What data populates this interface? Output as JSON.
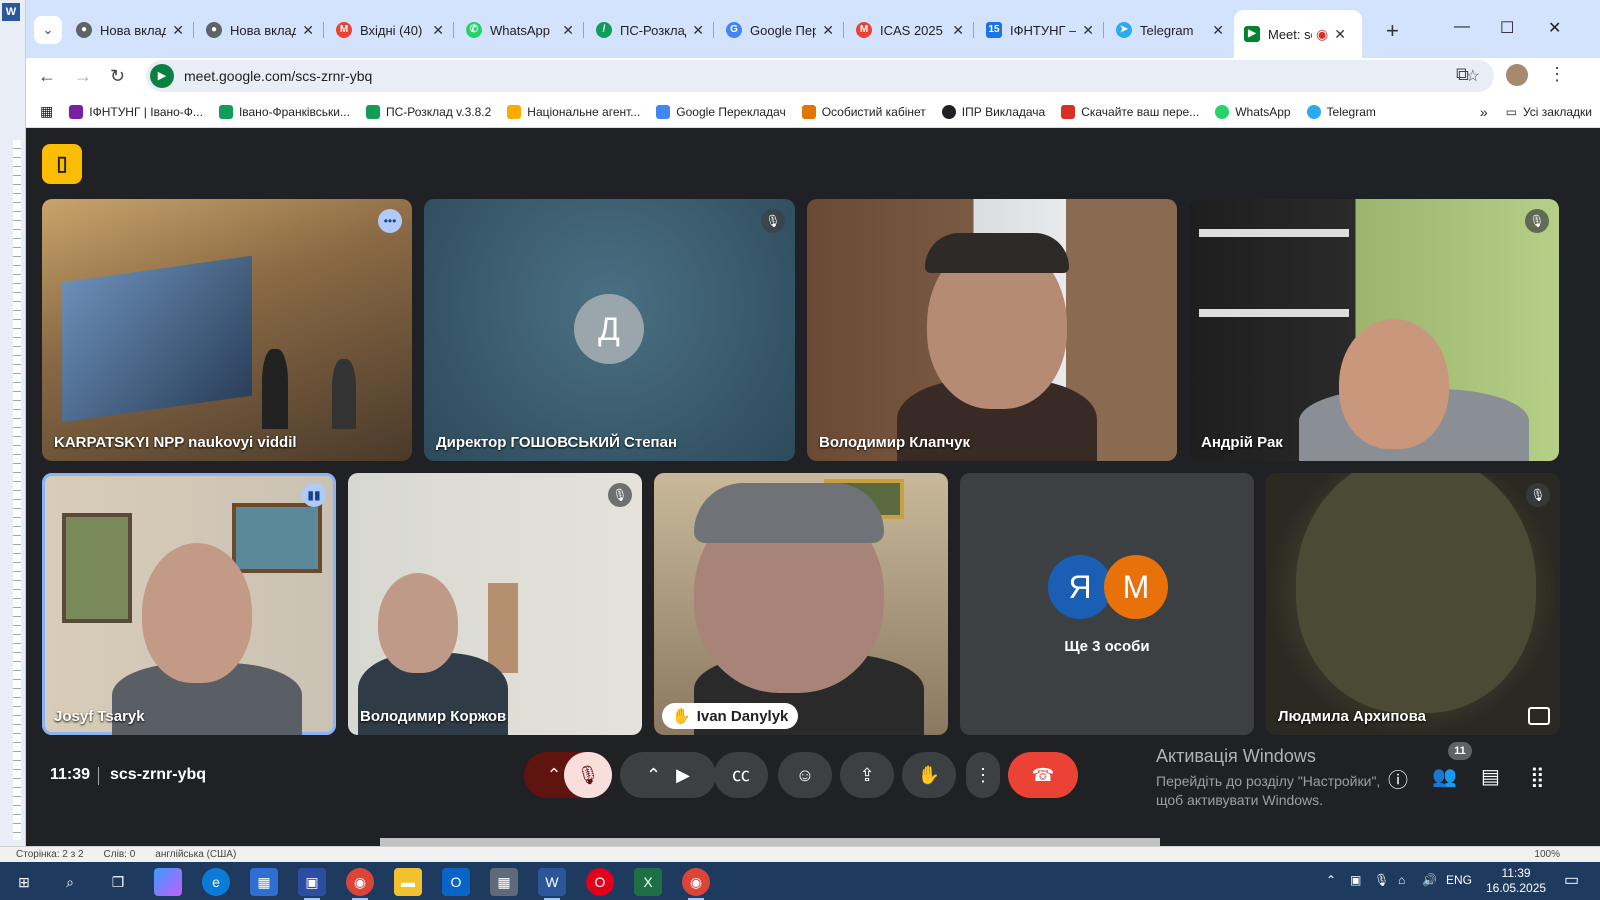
{
  "word": {
    "status_page": "Сторінка: 2 з 2",
    "status_words": "Слів: 0",
    "status_lang": "англійська (США)",
    "zoom": "100%"
  },
  "tabs": [
    {
      "title": "Нова вкладка",
      "icon": "chrome-icon",
      "color": "#5f6368"
    },
    {
      "title": "Нова вкладка",
      "icon": "chrome-icon",
      "color": "#5f6368"
    },
    {
      "title": "Вхідні (40)",
      "icon": "gmail-icon",
      "color": "#ea4335"
    },
    {
      "title": "WhatsApp",
      "icon": "whatsapp-icon",
      "color": "#25d366"
    },
    {
      "title": "ПС-Розклад",
      "icon": "ps-rozklad-icon",
      "color": "#0f9d58"
    },
    {
      "title": "Google Перекладач",
      "icon": "google-translate-icon",
      "color": "#4285f4"
    },
    {
      "title": "ICAS 2025",
      "icon": "gmail-icon",
      "color": "#ea4335"
    },
    {
      "title": "ІФНТУНГ –",
      "icon": "calendar-icon",
      "color": "#1a73e8"
    },
    {
      "title": "Telegram",
      "icon": "telegram-icon",
      "color": "#2aabee"
    },
    {
      "title": "Meet: scs",
      "icon": "meet-icon",
      "color": "#00832d"
    }
  ],
  "url": "meet.google.com/scs-zrnr-ybq",
  "bookmarks": [
    {
      "label": "ІФНТУНГ | Івано-Ф...",
      "color": "#7b1fa2"
    },
    {
      "label": "Івано-Франківськи...",
      "color": "#0f9d58"
    },
    {
      "label": "ПС-Розклад v.3.8.2",
      "color": "#0f9d58"
    },
    {
      "label": "Національне агент...",
      "color": "#f9ab00"
    },
    {
      "label": "Google Перекладач",
      "color": "#4285f4"
    },
    {
      "label": "Особистий кабінет",
      "color": "#e37400"
    },
    {
      "label": "ІПР Викладача",
      "color": "#202124"
    },
    {
      "label": "Скачайте ваш пере...",
      "color": "#d93025"
    },
    {
      "label": "WhatsApp",
      "color": "#25d366"
    },
    {
      "label": "Telegram",
      "color": "#2aabee"
    }
  ],
  "bookmarks_all": "Усі закладки",
  "meet": {
    "participants": [
      {
        "name": "KARPATSKYI NPP naukovyi viddil",
        "audio": "speaking"
      },
      {
        "name": "Директор ГОШОВСЬКИЙ Степан",
        "audio": "muted",
        "initial": "Д"
      },
      {
        "name": "Володимир Клапчук",
        "audio": "none"
      },
      {
        "name": "Андрій Рак",
        "audio": "muted"
      },
      {
        "name": "Josyf Tsaryk",
        "audio": "speaking"
      },
      {
        "name": "Володимир Коржов",
        "audio": "muted"
      },
      {
        "name": "Ivan Danylyk",
        "audio": "hand-raised"
      },
      {
        "name": "Людмила Архипова",
        "audio": "muted"
      }
    ],
    "others": {
      "label": "Ще 3 особи",
      "initials": [
        "Я",
        "М"
      ]
    },
    "time": "11:39",
    "code": "scs-zrnr-ybq",
    "people_count": "11",
    "activation_title": "Активація Windows",
    "activation_text": "Перейдіть до розділу \"Настройки\", щоб активувати Windows."
  },
  "taskbar": {
    "lang": "ENG",
    "time": "11:39",
    "date": "16.05.2025"
  }
}
